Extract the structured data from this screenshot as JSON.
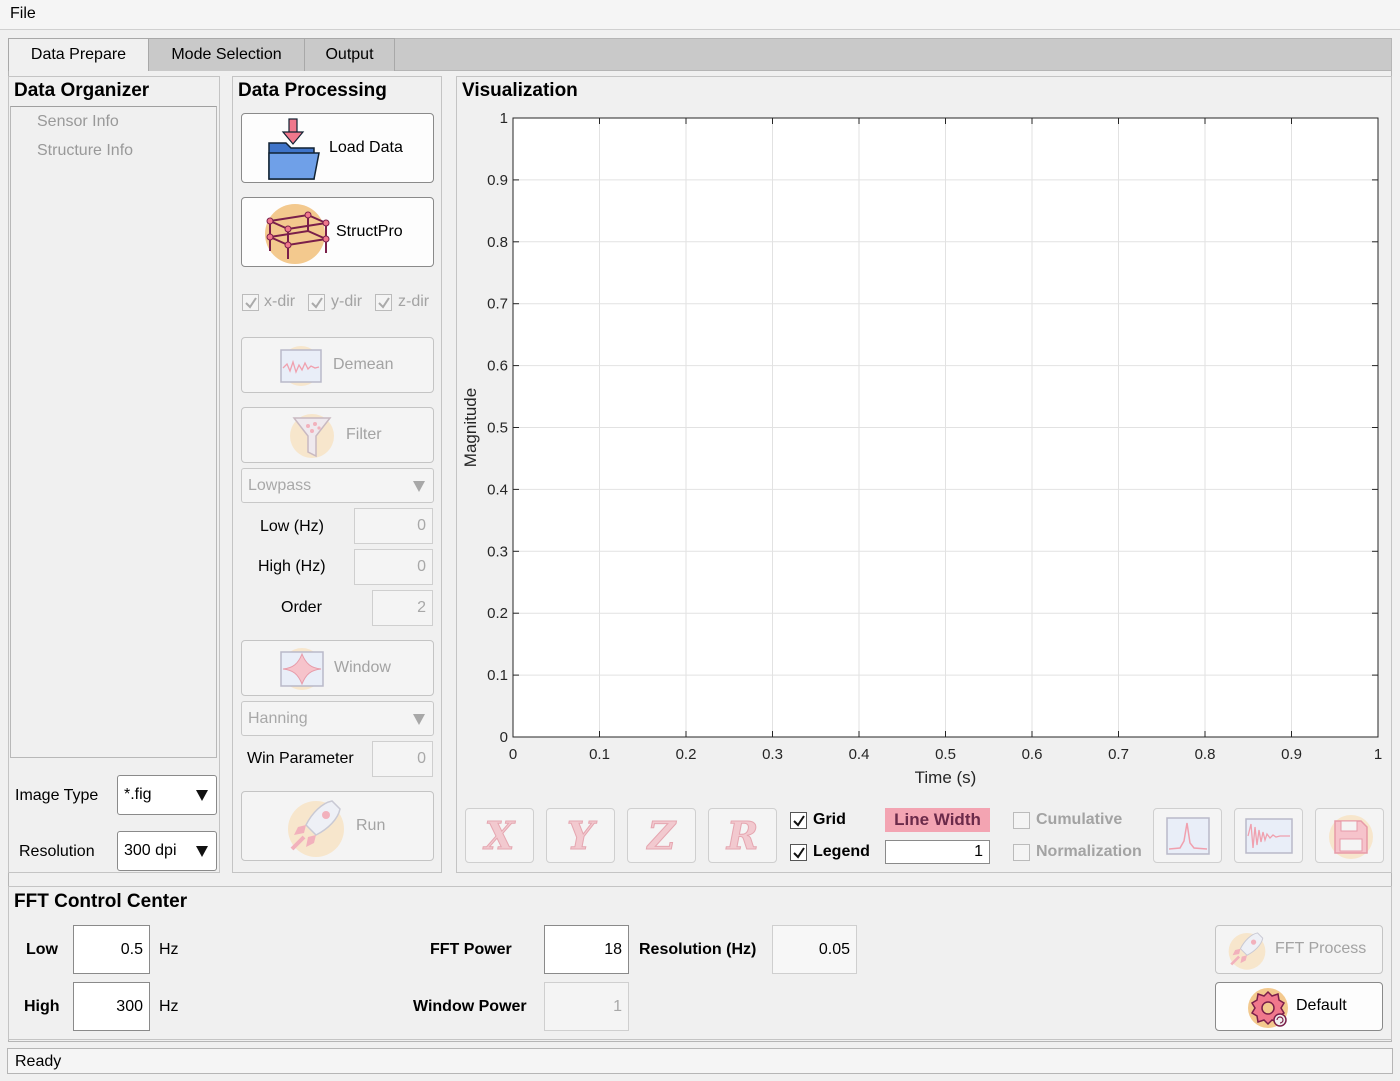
{
  "menu": {
    "file": "File"
  },
  "tabs": [
    {
      "label": "Data Prepare"
    },
    {
      "label": "Mode Selection"
    },
    {
      "label": "Output"
    }
  ],
  "data_organizer": {
    "title": "Data Organizer",
    "items": [
      "Sensor Info",
      "Structure Info"
    ],
    "image_type_label": "Image Type",
    "image_type_value": "*.fig",
    "resolution_label": "Resolution",
    "resolution_value": "300 dpi"
  },
  "data_processing": {
    "title": "Data Processing",
    "load_data": "Load Data",
    "structpro": "StructPro",
    "dir_x": "x-dir",
    "dir_y": "y-dir",
    "dir_z": "z-dir",
    "demean": "Demean",
    "filter": "Filter",
    "filter_type": "Lowpass",
    "low_label": "Low (Hz)",
    "low_value": "0",
    "high_label": "High (Hz)",
    "high_value": "0",
    "order_label": "Order",
    "order_value": "2",
    "window": "Window",
    "window_type": "Hanning",
    "win_param_label": "Win Parameter",
    "win_param_value": "0",
    "run": "Run"
  },
  "visualization": {
    "title": "Visualization",
    "axis_buttons": [
      "X",
      "Y",
      "Z",
      "R"
    ],
    "grid_label": "Grid",
    "legend_label": "Legend",
    "line_width_label": "Line Width",
    "line_width_value": "1",
    "cumulative_label": "Cumulative",
    "normalization_label": "Normalization",
    "colors": {
      "line_width_bg": "#f3a4b2",
      "line_width_text": "#6b2a4a"
    }
  },
  "chart_data": {
    "type": "line",
    "title": "",
    "xlabel": "Time (s)",
    "ylabel": "Magnitude",
    "xlim": [
      0,
      1
    ],
    "ylim": [
      0,
      1
    ],
    "xticks": [
      "0",
      "0.1",
      "0.2",
      "0.3",
      "0.4",
      "0.5",
      "0.6",
      "0.7",
      "0.8",
      "0.9",
      "1"
    ],
    "yticks": [
      "0",
      "0.1",
      "0.2",
      "0.3",
      "0.4",
      "0.5",
      "0.6",
      "0.7",
      "0.8",
      "0.9",
      "1"
    ],
    "grid": true,
    "series": []
  },
  "fft": {
    "title": "FFT Control Center",
    "low_label": "Low",
    "low_value": "0.5",
    "low_unit": "Hz",
    "high_label": "High",
    "high_value": "300",
    "high_unit": "Hz",
    "fft_power_label": "FFT Power",
    "fft_power_value": "18",
    "resolution_label": "Resolution (Hz)",
    "resolution_value": "0.05",
    "window_power_label": "Window Power",
    "window_power_value": "1",
    "fft_process": "FFT Process",
    "default": "Default"
  },
  "status": {
    "text": "Ready"
  }
}
